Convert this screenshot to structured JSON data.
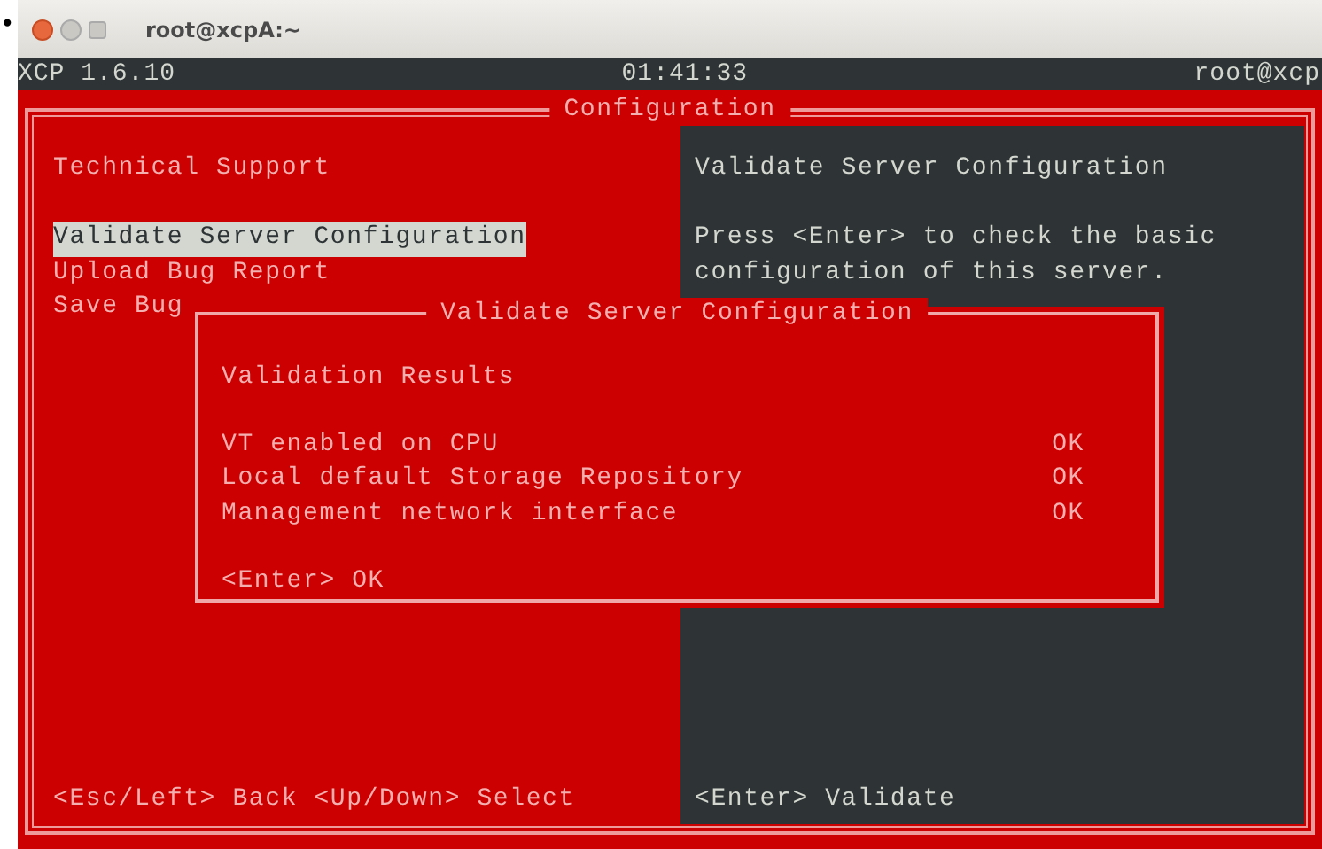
{
  "bullet": "•",
  "window": {
    "title": "root@xcpA:~"
  },
  "status_bar": {
    "product": "XCP 1.6.10",
    "time": "01:41:33",
    "user": "root@xcp"
  },
  "panel": {
    "title": "Configuration",
    "menu_heading": "Technical Support",
    "menu_items": [
      {
        "label": "Validate Server Configuration",
        "selected": true
      },
      {
        "label": "Upload Bug Report",
        "selected": false
      },
      {
        "label": "Save Bug",
        "selected": false
      }
    ],
    "footer": "<Esc/Left> Back <Up/Down> Select"
  },
  "details": {
    "title": "Validate Server Configuration",
    "description_lines": [
      "Press <Enter> to check the basic",
      "configuration of this server."
    ],
    "footer": "<Enter> Validate"
  },
  "dialog": {
    "title": "Validate Server Configuration",
    "heading": "Validation Results",
    "results": [
      {
        "label": "VT enabled on CPU",
        "status": "OK"
      },
      {
        "label": "Local default Storage Repository",
        "status": "OK"
      },
      {
        "label": "Management network interface",
        "status": "OK"
      }
    ],
    "footer": "<Enter> OK"
  }
}
